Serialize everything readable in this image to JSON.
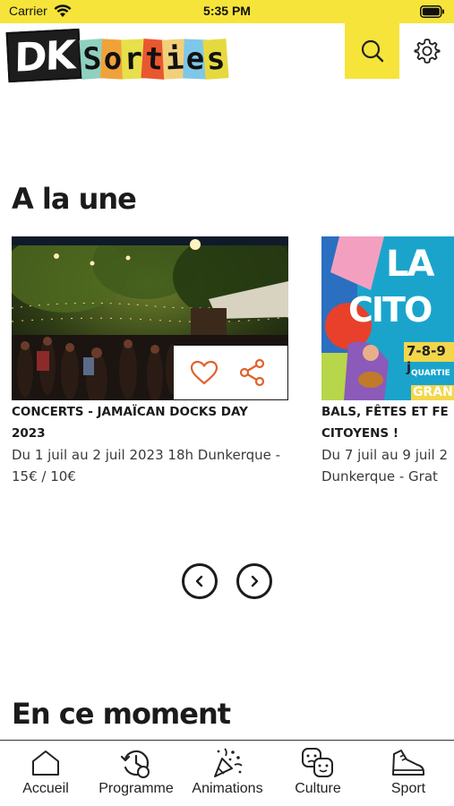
{
  "status_bar": {
    "carrier": "Carrier",
    "time": "5:35 PM"
  },
  "header": {
    "logo_dk": "DK",
    "logo_letters": [
      "S",
      "o",
      "r",
      "t",
      "i",
      "e",
      "s"
    ],
    "logo_colors": [
      "#8fd0c0",
      "#f0a23a",
      "#e7e04a",
      "#e9572f",
      "#f2d07a",
      "#7fc7e8",
      "#e6d93f"
    ],
    "search_icon": "search-icon",
    "settings_icon": "gear-icon",
    "accent_color": "#f6e43a"
  },
  "a_la_une": {
    "title": "A la une",
    "cards": [
      {
        "title_line1": "CONCERTS - JAMAÏCAN DOCKS DAY",
        "title_line2": "2023",
        "desc_line1": "Du 1 juil au 2 juil 2023 18h Dunkerque -",
        "desc_line2": "15€ / 10€"
      },
      {
        "title_line1": "BALS, FÊTES ET FE",
        "title_line2": "CITOYENS !",
        "desc_line1": "Du 7 juil au 9 juil 2",
        "desc_line2": "Dunkerque - Grat",
        "poster_text_1": "LA",
        "poster_text_2": "CITO",
        "poster_dates": "7-8-9 j",
        "poster_text_3": "QUARTIE",
        "poster_text_4": "GRAN"
      }
    ],
    "favorite_icon": "heart-icon",
    "share_icon": "share-icon",
    "action_color": "#e0622a"
  },
  "en_ce_moment": {
    "title": "En ce moment"
  },
  "tab_bar": {
    "tabs": [
      {
        "label": "Accueil",
        "icon": "home-icon"
      },
      {
        "label": "Programme",
        "icon": "clock-history-icon"
      },
      {
        "label": "Animations",
        "icon": "party-popper-icon"
      },
      {
        "label": "Culture",
        "icon": "theater-masks-icon"
      },
      {
        "label": "Sport",
        "icon": "sneaker-icon"
      }
    ]
  }
}
